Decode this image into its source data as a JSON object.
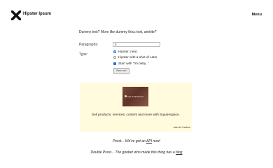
{
  "header": {
    "logo_text": "Hipster Ipsum",
    "menu_label": "Menu"
  },
  "intro": "Dummy text? More like dummy thicc text, amirite?",
  "form": {
    "paragraphs_label": "Paragraphs:",
    "paragraphs_value": "5",
    "type_label": "Type:",
    "type_options": [
      "Hipster, neat.",
      "Hipster with a shot of Latin."
    ],
    "selected_type": 0,
    "start_with_label": "Start with 'I'm baby...'",
    "start_with_checked": true,
    "submit_label": "Beer me!"
  },
  "ad": {
    "image_text": "SQUARESPACE",
    "text": "Sell products, services, content and more with Squarespace.",
    "via": "ads via Carbon"
  },
  "footer": {
    "line1_prefix": "Pssst... We've got an ",
    "line1_link": "API",
    "line1_suffix": " now!",
    "line2_prefix": "Double Pssst... The goober who made this thing has a ",
    "line2_link": "blog"
  },
  "icons": {
    "logo": "x-cross-icon"
  },
  "colors": {
    "accent": "#2a6fd6",
    "ad_background": "#fffbdc"
  }
}
